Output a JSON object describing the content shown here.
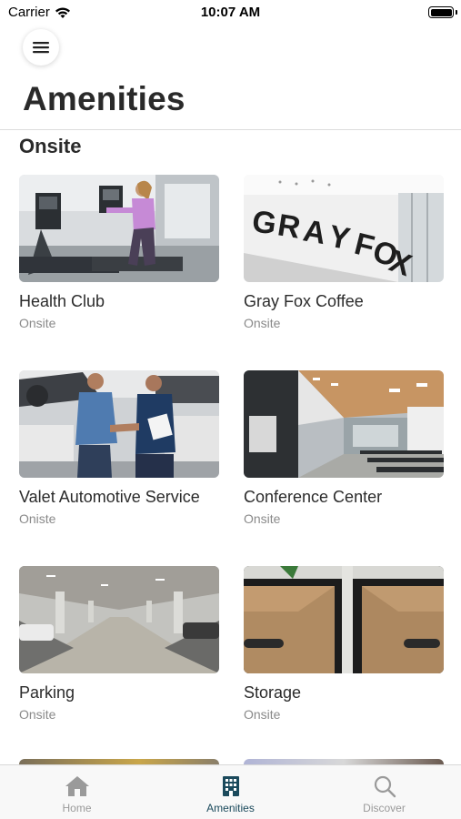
{
  "status_bar": {
    "carrier": "Carrier",
    "time": "10:07 AM"
  },
  "header": {
    "title": "Amenities"
  },
  "section": {
    "title": "Onsite"
  },
  "cards": [
    {
      "name": "Health Club",
      "subtitle": "Onsite",
      "image": "treadmill-gym-photo"
    },
    {
      "name": "Gray Fox Coffee",
      "subtitle": "Onsite",
      "image": "grayfox-sign-photo"
    },
    {
      "name": "Valet Automotive Service",
      "subtitle": "Oniste",
      "image": "mechanic-handshake-photo"
    },
    {
      "name": "Conference Center",
      "subtitle": "Onsite",
      "image": "conference-room-photo"
    },
    {
      "name": "Parking",
      "subtitle": "Onsite",
      "image": "parking-garage-photo"
    },
    {
      "name": "Storage",
      "subtitle": "Onsite",
      "image": "storage-boxes-photo"
    }
  ],
  "tab_bar": {
    "active": "amenities",
    "tabs": [
      {
        "id": "home",
        "label": "Home",
        "icon": "home-icon"
      },
      {
        "id": "amenities",
        "label": "Amenities",
        "icon": "building-icon"
      },
      {
        "id": "discover",
        "label": "Discover",
        "icon": "search-icon"
      }
    ]
  },
  "colors": {
    "accent": "#1b4a5c",
    "inactive": "#9a9a9a",
    "card_title": "#2b2b2b",
    "card_subtitle": "#8a8a8a"
  }
}
